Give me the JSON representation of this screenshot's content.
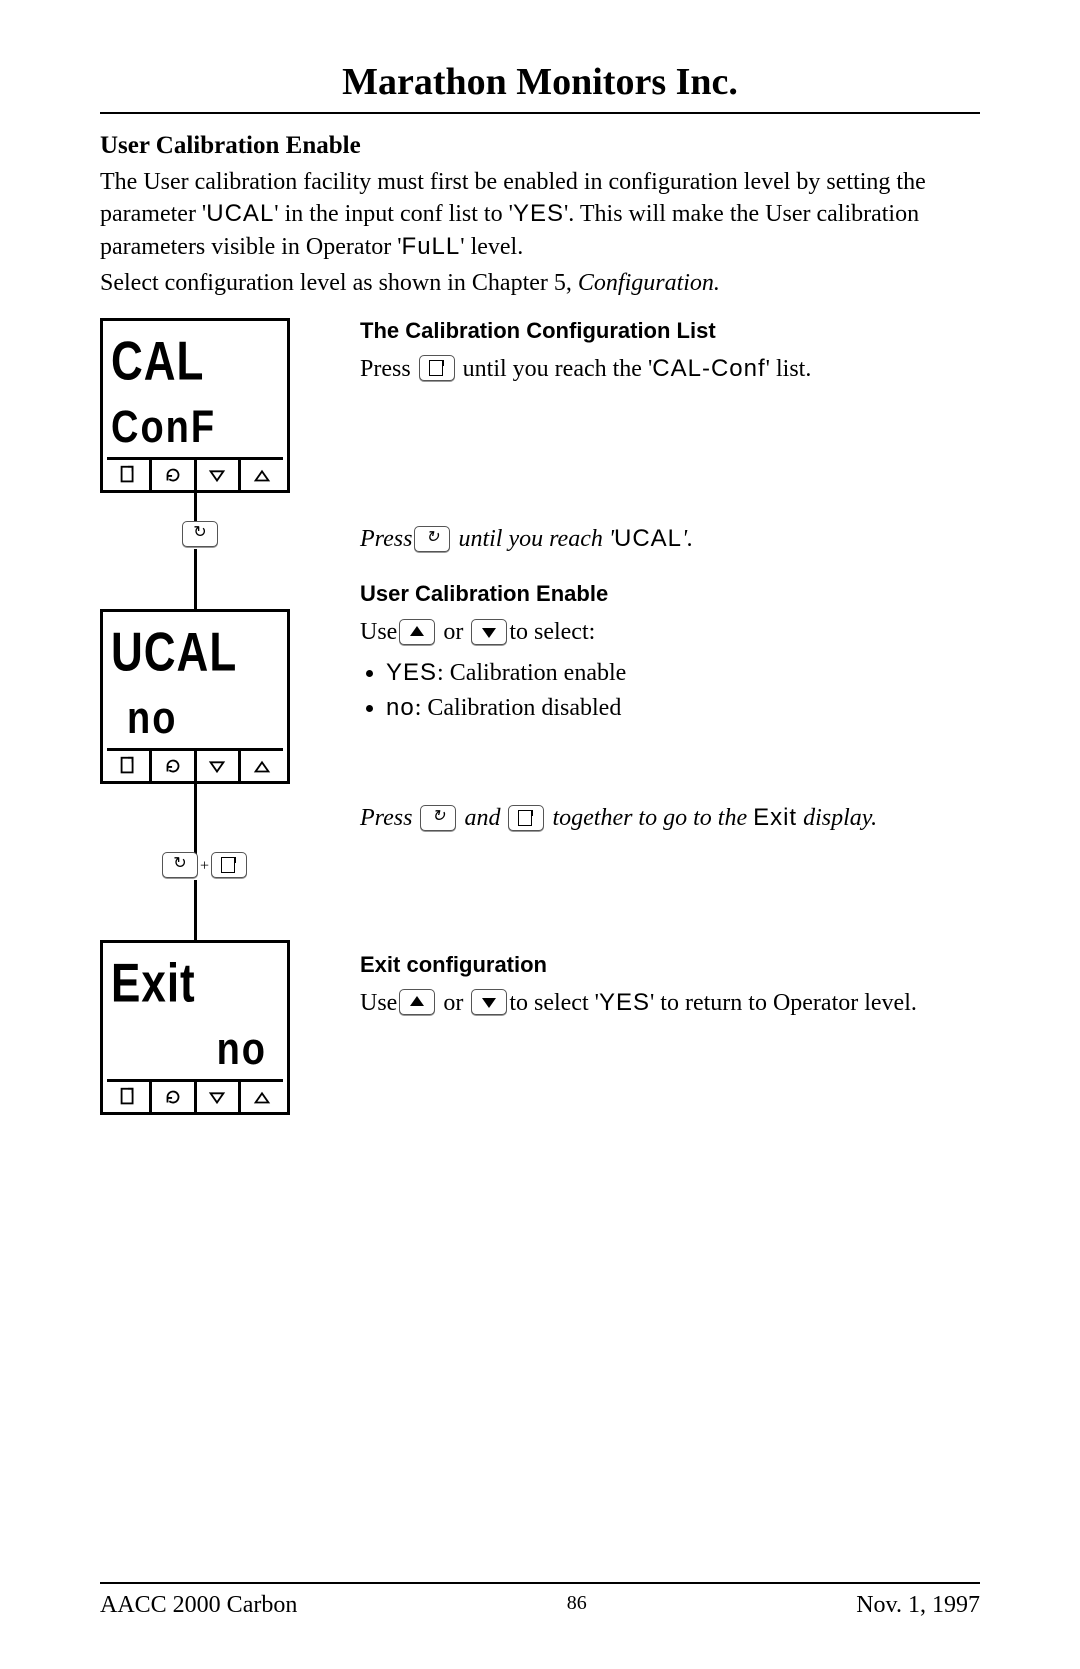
{
  "header": {
    "company": "Marathon Monitors Inc."
  },
  "section": {
    "title": "User Calibration Enable",
    "intro_parts": {
      "p1a": "The User calibration facility must first be enabled in configuration level by setting the parameter '",
      "ucal": "UCAL",
      "p1b": "' in the input conf list to '",
      "yes": "YES",
      "p1c": "'.   This will make the User calibration parameters visible in Operator '",
      "full": "FuLL",
      "p1d": "' level.",
      "p2a": "Select configuration level as shown in Chapter 5, ",
      "p2b": "Configuration."
    }
  },
  "displays": {
    "cal": {
      "line1": "CAL",
      "line2": "ConF"
    },
    "ucal": {
      "line1": "UCAL",
      "line2": "no"
    },
    "exit": {
      "line1": "Exit",
      "line2": "no"
    }
  },
  "connector_badges": {
    "loop_only": "↻",
    "plus": "+"
  },
  "steps": {
    "cal_title": "The Calibration Configuration List",
    "cal_text_a": "Press ",
    "cal_text_b": " until you reach the '",
    "cal_code": "CAL-Conf",
    "cal_text_c": "' list.",
    "to_ucal_a": "Press",
    "to_ucal_b": " until you reach '",
    "to_ucal_code": "UCAL",
    "to_ucal_c": "'.",
    "ucal_title": "User Calibration Enable",
    "ucal_use_a": "Use",
    "ucal_use_b": " or ",
    "ucal_use_c": "to select:",
    "bullet1_code": "YES",
    "bullet1_text": ":   Calibration enable",
    "bullet2_code": "no",
    "bullet2_text": ":    Calibration disabled",
    "to_exit_a": "Press ",
    "to_exit_b": " and ",
    "to_exit_c": " together to go to the ",
    "to_exit_code": "Exit",
    "to_exit_d": " display.",
    "exit_title": "Exit configuration",
    "exit_a": "Use",
    "exit_b": " or ",
    "exit_c": "to select '",
    "exit_yes": "YES",
    "exit_d": "' to return to Operator level."
  },
  "footer": {
    "left": "AACC 2000 Carbon",
    "center": "86",
    "right": "Nov.  1, 1997"
  },
  "icons": {
    "page": "page-icon",
    "loop": "loop-icon",
    "down": "down-triangle-icon",
    "up": "up-triangle-icon"
  }
}
